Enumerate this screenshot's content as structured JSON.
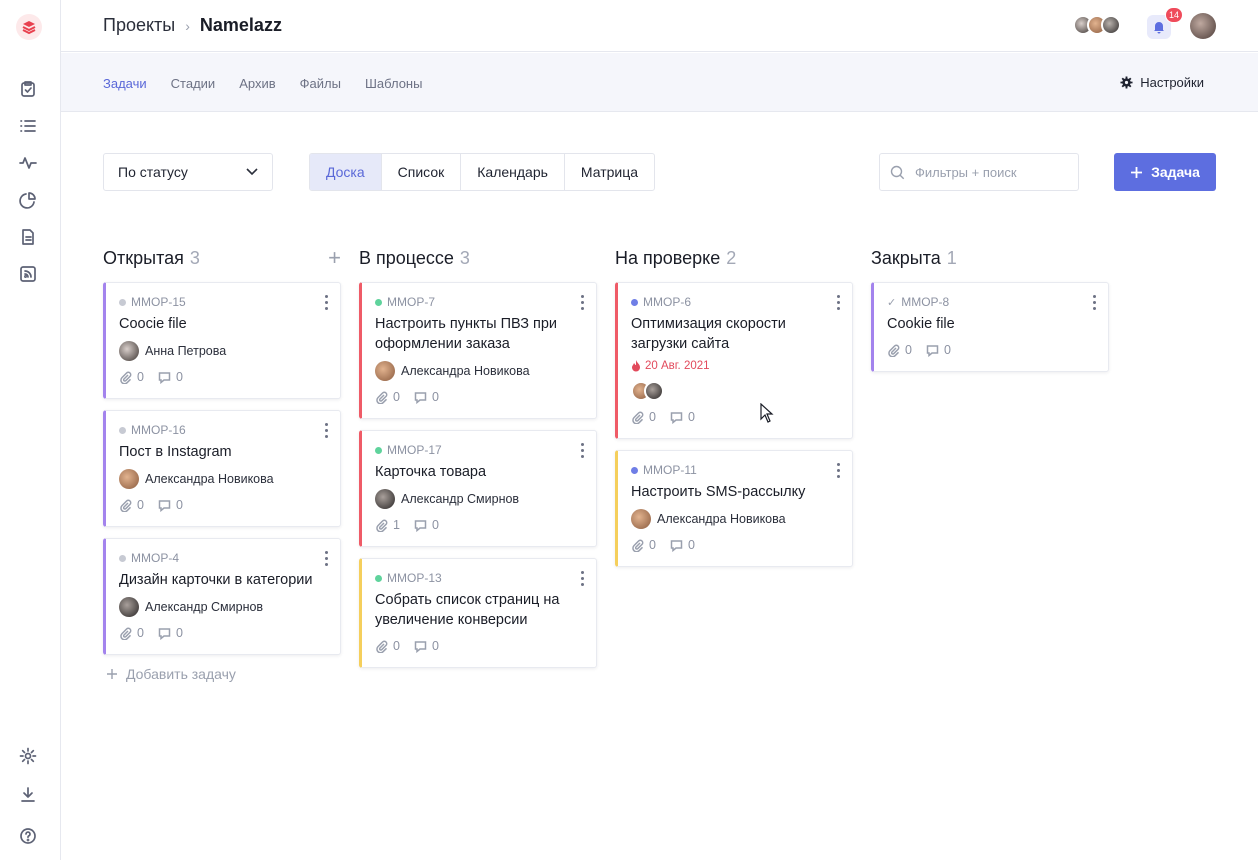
{
  "header": {
    "breadcrumb_root": "Проекты",
    "breadcrumb_sep": "›",
    "project": "Namelazz",
    "notifications": "14"
  },
  "subnav": {
    "tabs": [
      "Задачи",
      "Стадии",
      "Архив",
      "Файлы",
      "Шаблоны"
    ],
    "active_tab": "Задачи",
    "settings_label": "Настройки"
  },
  "toolbar": {
    "group_by": "По статусу",
    "views": [
      "Доска",
      "Список",
      "Календарь",
      "Матрица"
    ],
    "active_view": "Доска",
    "search_placeholder": "Фильтры + поиск",
    "add_task_label": "Задача"
  },
  "colors": {
    "accent": "#5d6ee0",
    "purple": "#a383ed",
    "red": "#ef5b67",
    "yellow": "#f5cf5c",
    "green": "#5fd39c",
    "blue": "#6f7ee6",
    "gray": "#c7cad3"
  },
  "columns": [
    {
      "name": "Открытая",
      "count": "3",
      "add_label": "Добавить задачу",
      "cards": [
        {
          "id": "MMOP-15",
          "title": "Coocie file",
          "assignee": "Анна Петрова",
          "files": "0",
          "comments": "0",
          "border": "#a383ed",
          "dot": "#c7cad3"
        },
        {
          "id": "MMOP-16",
          "title": "Пост в Instagram",
          "assignee": "Александра Новикова",
          "files": "0",
          "comments": "0",
          "border": "#a383ed",
          "dot": "#c7cad3"
        },
        {
          "id": "MMOP-4",
          "title": "Дизайн карточки в категории",
          "assignee": "Александр Смирнов",
          "files": "0",
          "comments": "0",
          "border": "#a383ed",
          "dot": "#c7cad3"
        }
      ]
    },
    {
      "name": "В процессе",
      "count": "3",
      "cards": [
        {
          "id": "MMOP-7",
          "title": "Настроить пункты ПВЗ при оформлении заказа",
          "assignee": "Александра Новикова",
          "files": "0",
          "comments": "0",
          "border": "#ef5b67",
          "dot": "#5fd39c"
        },
        {
          "id": "MMOP-17",
          "title": "Карточка товара",
          "assignee": "Александр Смирнов",
          "files": "1",
          "comments": "0",
          "border": "#ef5b67",
          "dot": "#5fd39c"
        },
        {
          "id": "MMOP-13",
          "title": "Собрать список страниц на увеличение конверсии",
          "assignee": "",
          "files": "0",
          "comments": "0",
          "border": "#f5cf5c",
          "dot": "#5fd39c"
        }
      ]
    },
    {
      "name": "На проверке",
      "count": "2",
      "cards": [
        {
          "id": "MMOP-6",
          "title": "Оптимизация скорости загрузки сайта",
          "due": "20 Авг. 2021",
          "assignee": "",
          "multi": true,
          "files": "0",
          "comments": "0",
          "border": "#ef5b67",
          "dot": "#6f7ee6"
        },
        {
          "id": "MMOP-11",
          "title": "Настроить SMS-рассылку",
          "assignee": "Александра Новикова",
          "files": "0",
          "comments": "0",
          "border": "#f5cf5c",
          "dot": "#6f7ee6"
        }
      ]
    },
    {
      "name": "Закрыта",
      "count": "1",
      "cards": [
        {
          "id": "MMOP-8",
          "title": "Cookie file",
          "assignee": "",
          "files": "0",
          "comments": "0",
          "border": "#a383ed",
          "check": true
        }
      ]
    }
  ]
}
